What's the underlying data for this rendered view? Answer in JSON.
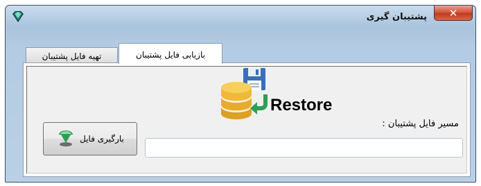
{
  "window": {
    "title": "پشتیبان گیری",
    "close_glyph": "✕"
  },
  "tabs": [
    {
      "label": "تهیه فایل پشتیبان",
      "selected": false
    },
    {
      "label": "بازیابی فایل پشتیبان",
      "selected": true
    }
  ],
  "restore_panel": {
    "heading": "Restore",
    "heading_icon": "database-save-icon",
    "path_label": "مسیر فایل پشتیبان :",
    "path_value": "",
    "load_button_label": "بارگیری فایل",
    "load_button_icon": "green-download-arrow-icon"
  },
  "colors": {
    "title_bar": "#aac4dd",
    "close_button": "#c8462b",
    "database_gold": "#f0b93a",
    "floppy_blue": "#3a6fb8",
    "arrow_green": "#2f9e55"
  }
}
